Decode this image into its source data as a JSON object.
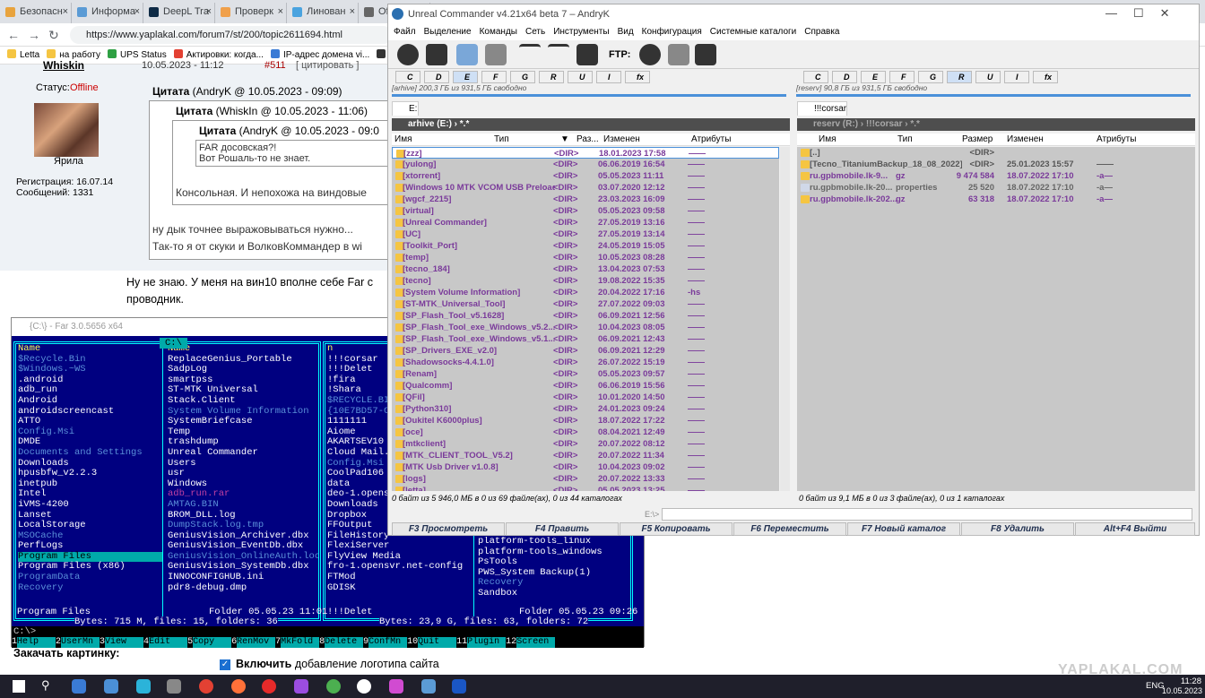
{
  "browser": {
    "tabs": [
      {
        "label": "Безопасн",
        "color": "#e8a33d"
      },
      {
        "label": "Информа",
        "color": "#5b9bd5"
      },
      {
        "label": "DeepL Tra",
        "color": "#0f2b46"
      },
      {
        "label": "Проверк",
        "color": "#f0a04b"
      },
      {
        "label": "Линован",
        "color": "#4aa3df"
      },
      {
        "label": "Of",
        "color": "#666"
      }
    ],
    "url": "https://www.yaplakal.com/forum7/st/200/topic2611694.html",
    "bookmarks": [
      "Letta",
      "на работу",
      "UPS Status",
      "Актировки: когда...",
      "IP-адрес домена vi...",
      "Наст"
    ]
  },
  "forum": {
    "username": "Whiskin",
    "post_date": "10.05.2023 - 11:12",
    "post_ref": "#511",
    "post_ref_action": "[ цитировать ]",
    "status_label": "Статус:",
    "status_value": "Offline",
    "rank": "Ярила",
    "registered": "Регистрация: 16.07.14",
    "messages": "Сообщений: 1331",
    "quote1_label": "Цитата",
    "quote1_meta": "(AndryK @ 10.05.2023 - 09:09)",
    "quote2_label": "Цитата",
    "quote2_meta": "(WhiskIn @ 10.05.2023 - 11:06)",
    "quote3_label": "Цитата",
    "quote3_meta": "(AndryK @ 10.05.2023 - 09:0",
    "quote3_line1": "FAR досовская?!",
    "quote3_line2": "Вот Рошаль-то не знает.",
    "quote2_text": "Консольная. И непохожа на виндовые",
    "quote1_text1": "ну дык точнее выражовываться нужно...",
    "quote1_text2": "Так-то я от скуки и ВолковКоммандер в wi",
    "body1": "Ну не знаю. У меня на вин10 вполне себе Far с",
    "body2": "проводник.",
    "attach_label": "Закачать картинку:",
    "logo_checkbox": "Включить",
    "logo_text": "добавление логотипа сайта",
    "watermark": "YAPLAKAL.COM"
  },
  "far": {
    "title": "{C:\\} - Far 3.0.5656 x64",
    "drive": "C:\\",
    "col_header": "Name",
    "left_col1": [
      "$Recycle.Bin",
      "$Windows.~WS",
      ".android",
      "adb_run",
      "Android",
      "androidscreencast",
      "ATTO",
      "Config.Msi",
      "DMDE",
      "Documents and Settings",
      "Downloads",
      "hpusbfw_v2.2.3",
      "inetpub",
      "Intel",
      "iVMS-4200",
      "Lanset",
      "LocalStorage",
      "MSOCache",
      "PerfLogs",
      "Program Files",
      "Program Files (x86)",
      "ProgramData",
      "Recovery"
    ],
    "left_col2": [
      "ReplaceGenius_Portable",
      "SadpLog",
      "smartpss",
      "ST-MTK Universal",
      "Stack.Client",
      "System Volume Information",
      "SystemBriefcase",
      "Temp",
      "trashdump",
      "Unreal Commander",
      "Users",
      "usr",
      "Windows",
      "adb_run.rar",
      "AMTAG.BIN",
      "BROM_DLL.log",
      "DumpStack.log.tmp",
      "GeniusVision_Archiver.dbx",
      "GeniusVision_EventDb.dbx",
      "GeniusVision_OnlineAuth.lock",
      "GeniusVision_SystemDb.dbx",
      "INNOCONFIGHUB.ini",
      "pdr8-debug.dmp"
    ],
    "right_col1": [
      "n",
      "!!!corsar",
      "!!!Delet",
      "!fira",
      "!Shara",
      "$RECYCLE.BIN",
      "{10E7BD57-C9",
      "1111111",
      "Aiome",
      "AKARTSEV10",
      "Cloud Mail.R",
      "Config.Msi",
      "CoolPad106",
      "data",
      "deo-1.opensv",
      "Downloads",
      "Dropbox",
      "FFOutput",
      "FileHistory",
      "FlexiServer",
      "FlyView Media",
      "fro-1.opensvr.net-config",
      "FTMod",
      "GDISK"
    ],
    "right_col2": [
      "platform-tools_linux",
      "platform-tools_windows",
      "PsTools",
      "PWS_System Backup(1)",
      "Recovery",
      "Sandbox"
    ],
    "left_status_name": "Program Files",
    "left_status_info": "Folder 05.05.23 11:01",
    "left_totals": "Bytes: 715 M, files: 15, folders: 36",
    "right_status_name": "!!!Delet",
    "right_status_info": "Folder 05.05.23 09:26",
    "right_totals": "Bytes: 23,9 G, files: 63, folders: 72",
    "prompt": "C:\\>",
    "keys": [
      {
        "n": "1",
        "l": "Help"
      },
      {
        "n": "2",
        "l": "UserMn"
      },
      {
        "n": "3",
        "l": "View"
      },
      {
        "n": "4",
        "l": "Edit"
      },
      {
        "n": "5",
        "l": "Copy"
      },
      {
        "n": "6",
        "l": "RenMov"
      },
      {
        "n": "7",
        "l": "MkFold"
      },
      {
        "n": "8",
        "l": "Delete"
      },
      {
        "n": "9",
        "l": "ConfMn"
      },
      {
        "n": "10",
        "l": "Quit"
      },
      {
        "n": "11",
        "l": "Plugin"
      },
      {
        "n": "12",
        "l": "Screen"
      }
    ]
  },
  "uc": {
    "title": "Unreal Commander v4.21x64 beta 7 – AndryK",
    "menu": [
      "Файл",
      "Выделение",
      "Команды",
      "Сеть",
      "Инструменты",
      "Вид",
      "Конфигурация",
      "Системные каталоги",
      "Справка"
    ],
    "ftp_label": "FTP:",
    "left_drives": [
      "C",
      "D",
      "E",
      "F",
      "G",
      "R",
      "U",
      "I",
      "fx"
    ],
    "right_drives": [
      "C",
      "D",
      "E",
      "F",
      "G",
      "R",
      "U",
      "I",
      "fx"
    ],
    "left_free": "[arhive] 200,3 ГБ из 931,5 ГБ свободно",
    "right_free": "[reserv] 90,8 ГБ из 931,5 ГБ свободно",
    "left_tab": "E:",
    "right_tab": "!!!corsar",
    "left_path": "arhive (E:)  ›  *.*",
    "right_path": "reserv (R:)  ›  !!!corsar  ›  *.*",
    "columns": {
      "name": "Имя",
      "type": "Тип",
      "size": "Раз...",
      "size_full": "Размер",
      "date": "Изменен",
      "attr": "Атрибуты"
    },
    "left_files": [
      [
        "[zzz]",
        "<DIR>",
        "18.01.2023 17:58",
        "——"
      ],
      [
        "[yulong]",
        "<DIR>",
        "06.06.2019 16:54",
        "——"
      ],
      [
        "[xtorrent]",
        "<DIR>",
        "05.05.2023 11:11",
        "——"
      ],
      [
        "[Windows 10 MTK VCOM USB Preload...]",
        "<DIR>",
        "03.07.2020 12:12",
        "——"
      ],
      [
        "[wgcf_2215]",
        "<DIR>",
        "23.03.2023 16:09",
        "——"
      ],
      [
        "[virtual]",
        "<DIR>",
        "05.05.2023 09:58",
        "——"
      ],
      [
        "[Unreal Commander]",
        "<DIR>",
        "27.05.2019 13:16",
        "——"
      ],
      [
        "[UC]",
        "<DIR>",
        "27.05.2019 13:14",
        "——"
      ],
      [
        "[Toolkit_Port]",
        "<DIR>",
        "24.05.2019 15:05",
        "——"
      ],
      [
        "[temp]",
        "<DIR>",
        "10.05.2023 08:28",
        "——"
      ],
      [
        "[tecno_184]",
        "<DIR>",
        "13.04.2023 07:53",
        "——"
      ],
      [
        "[tecno]",
        "<DIR>",
        "19.08.2022 15:35",
        "——"
      ],
      [
        "[System Volume Information]",
        "<DIR>",
        "20.04.2022 17:16",
        "-hs"
      ],
      [
        "[ST-MTK_Universal_Tool]",
        "<DIR>",
        "27.07.2022 09:03",
        "——"
      ],
      [
        "[SP_Flash_Tool_v5.1628]",
        "<DIR>",
        "06.09.2021 12:56",
        "——"
      ],
      [
        "[SP_Flash_Tool_exe_Windows_v5.2...]",
        "<DIR>",
        "10.04.2023 08:05",
        "——"
      ],
      [
        "[SP_Flash_Tool_exe_Windows_v5.1...]",
        "<DIR>",
        "06.09.2021 12:43",
        "——"
      ],
      [
        "[SP_Drivers_EXE_v2.0]",
        "<DIR>",
        "06.09.2021 12:29",
        "——"
      ],
      [
        "[Shadowsocks-4.4.1.0]",
        "<DIR>",
        "26.07.2022 15:19",
        "——"
      ],
      [
        "[Renam]",
        "<DIR>",
        "05.05.2023 09:57",
        "——"
      ],
      [
        "[Qualcomm]",
        "<DIR>",
        "06.06.2019 15:56",
        "——"
      ],
      [
        "[QFil]",
        "<DIR>",
        "10.01.2020 14:50",
        "——"
      ],
      [
        "[Python310]",
        "<DIR>",
        "24.01.2023 09:24",
        "——"
      ],
      [
        "[Oukitel K6000plus]",
        "<DIR>",
        "18.07.2022 17:22",
        "——"
      ],
      [
        "[oce]",
        "<DIR>",
        "08.04.2021 12:49",
        "——"
      ],
      [
        "[mtkclient]",
        "<DIR>",
        "20.07.2022 08:12",
        "——"
      ],
      [
        "[MTK_CLIENT_TOOL_V5.2]",
        "<DIR>",
        "20.07.2022 11:34",
        "——"
      ],
      [
        "[MTK Usb Driver v1.0.8]",
        "<DIR>",
        "10.04.2023 09:02",
        "——"
      ],
      [
        "[logs]",
        "<DIR>",
        "20.07.2022 13:33",
        "——"
      ],
      [
        "[letta]",
        "<DIR>",
        "05.05.2023 13:25",
        "——"
      ]
    ],
    "right_files": [
      [
        "[..]",
        "",
        "<DIR>",
        "",
        ""
      ],
      [
        "[Tecno_TitaniumBackup_18_08_2022]",
        "",
        "<DIR>",
        "25.01.2023 15:57",
        "——"
      ],
      [
        "ru.gpbmobile.lk-9...",
        "gz",
        "9 474 584",
        "18.07.2022 17:10",
        "-a—"
      ],
      [
        "ru.gpbmobile.lk-20...",
        "properties",
        "25 520",
        "18.07.2022 17:10",
        "-a—"
      ],
      [
        "ru.gpbmobile.lk-202...",
        "gz",
        "63 318",
        "18.07.2022 17:10",
        "-a—"
      ]
    ],
    "left_info": "0 байт из 5 946,0 МБ в 0 из 69 файле(ах), 0 из 44 каталогах",
    "right_info": "0 байт из 9,1 МБ в 0 из 3 файле(ах), 0 из 1 каталогах",
    "cmd_prompt": "E:\\>",
    "fkeys": [
      "F3 Просмотреть",
      "F4 Править",
      "F5 Копировать",
      "F6 Переместить",
      "F7 Новый каталог",
      "F8 Удалить",
      "Alt+F4 Выйти"
    ]
  },
  "taskbar": {
    "lang": "ENG",
    "time": "11:28",
    "date": "10.05.2023"
  }
}
